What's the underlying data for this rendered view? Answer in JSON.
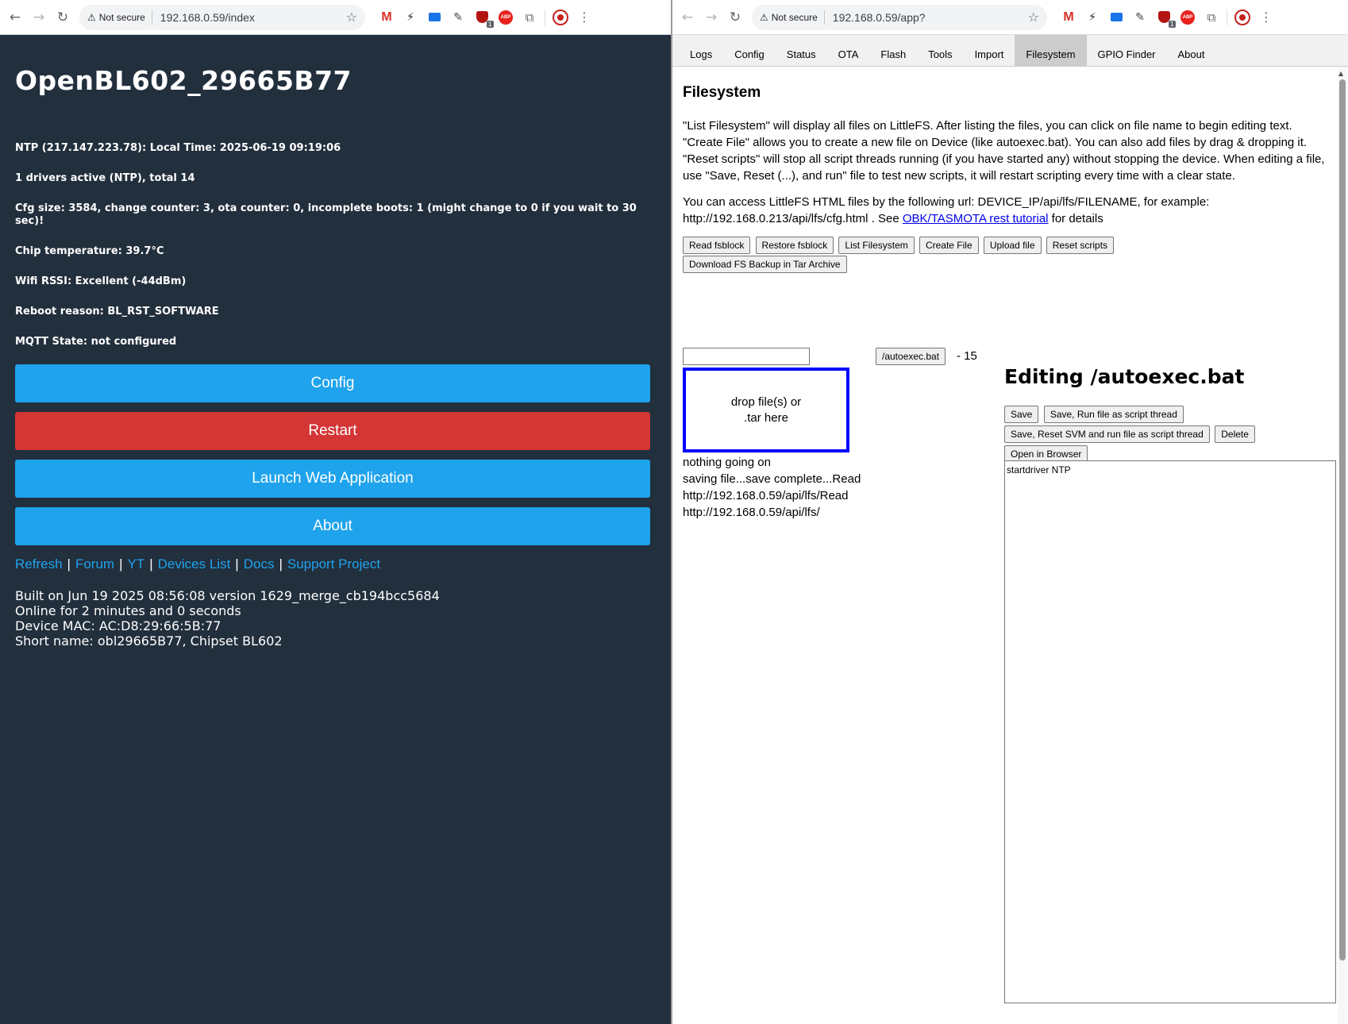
{
  "left_browser": {
    "not_secure": "Not secure",
    "url": "192.168.0.59/index"
  },
  "right_browser": {
    "not_secure": "Not secure",
    "url": "192.168.0.59/app?"
  },
  "extensions": {
    "shield_badge": "1",
    "abp_label": "ABP"
  },
  "device": {
    "title": "OpenBL602_29665B77",
    "info": [
      "NTP (217.147.223.78): Local Time: 2025-06-19 09:19:06",
      "1 drivers active (NTP), total 14",
      "Cfg size: 3584, change counter: 3, ota counter: 0, incomplete boots: 1 (might change to 0 if you wait to 30 sec)!",
      "Chip temperature: 39.7°C",
      "Wifi RSSI: Excellent (-44dBm)",
      "Reboot reason: BL_RST_SOFTWARE",
      "MQTT State: not configured"
    ],
    "buttons": {
      "config": "Config",
      "restart": "Restart",
      "launch": "Launch Web Application",
      "about": "About"
    },
    "links": [
      "Refresh",
      "Forum",
      "YT",
      "Devices List",
      "Docs",
      "Support Project"
    ],
    "link_separator": "|",
    "build": [
      "Built on Jun 19 2025 08:56:08 version 1629_merge_cb194bcc5684",
      "Online for 2 minutes and 0 seconds",
      "Device MAC: AC:D8:29:66:5B:77",
      "Short name: obl29665B77, Chipset BL602"
    ]
  },
  "app": {
    "tabs": [
      "Logs",
      "Config",
      "Status",
      "OTA",
      "Flash",
      "Tools",
      "Import",
      "Filesystem",
      "GPIO Finder",
      "About"
    ],
    "active_tab": "Filesystem",
    "heading": "Filesystem",
    "para1": "\"List Filesystem\" will display all files on LittleFS. After listing the files, you can click on file name to begin editing text. \"Create File\" allows you to create a new file on Device (like autoexec.bat). You can also add files by drag & dropping it. \"Reset scripts\" will stop all script threads running (if you have started any) without stopping the device. When editing a file, use \"Save, Reset (...), and run\" file to test new scripts, it will restart scripting every time with a clear state.",
    "para2_prefix": "You can access LittleFS HTML files by the following url: DEVICE_IP/api/lfs/FILENAME, for example: http://192.168.0.213/api/lfs/cfg.html . See ",
    "para2_link": "OBK/TASMOTA rest tutorial",
    "para2_suffix": " for details",
    "fs_buttons": [
      "Read fsblock",
      "Restore fsblock",
      "List Filesystem",
      "Create File",
      "Upload file",
      "Reset scripts",
      "Download FS Backup in Tar Archive"
    ],
    "file_name_input_value": "",
    "file_entry": "/autoexec.bat",
    "file_size": "- 15",
    "drop_zone_line1": "drop file(s) or",
    "drop_zone_line2": ".tar here",
    "status_lines": [
      "nothing going on",
      "saving file...save complete...Read",
      "http://192.168.0.59/api/lfs/Read",
      "http://192.168.0.59/api/lfs/"
    ],
    "editing_title": "Editing /autoexec.bat",
    "editor_buttons": [
      "Save",
      "Save, Run file as script thread",
      "Save, Reset SVM and run file as script thread",
      "Delete",
      "Open in Browser"
    ],
    "editor_content": "startdriver NTP"
  },
  "colors": {
    "left_bg": "#222f3d",
    "button_blue": "#1fa3ec",
    "button_red": "#d43535",
    "drop_border": "#0000ff"
  }
}
